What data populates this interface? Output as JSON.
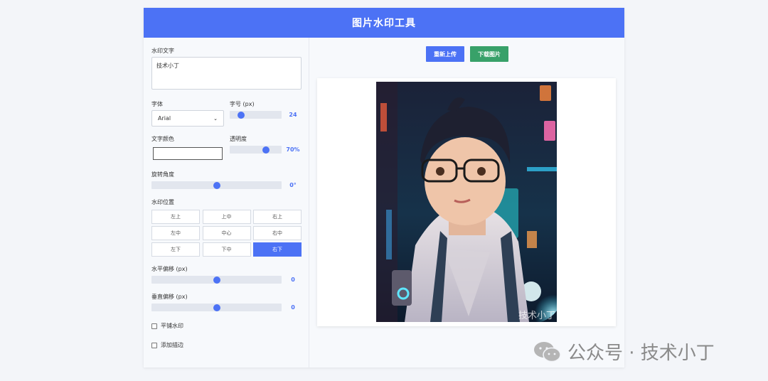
{
  "header": {
    "title": "图片水印工具"
  },
  "form": {
    "watermark_text_label": "水印文字",
    "watermark_text_value": "技术小丁",
    "font_label": "字体",
    "font_value": "Arial",
    "size_label": "字号 (px)",
    "size_value": "24",
    "size_level": 0.22,
    "color_label": "文字颜色",
    "color_value": "#ffffff",
    "opacity_label": "透明度",
    "opacity_value": "70%",
    "opacity_level": 0.7,
    "rotation_label": "旋转角度",
    "rotation_value": "0°",
    "rotation_level": 0.5,
    "position_label": "水印位置",
    "positions": [
      "左上",
      "上中",
      "右上",
      "左中",
      "中心",
      "右中",
      "左下",
      "下中",
      "右下"
    ],
    "active_position": "右下",
    "h_offset_label": "水平偏移 (px)",
    "h_offset_value": "0",
    "h_offset_level": 0.5,
    "v_offset_label": "垂直偏移 (px)",
    "v_offset_value": "0",
    "v_offset_level": 0.5,
    "tile_label": "平铺水印",
    "stroke_label": "添加描边"
  },
  "toolbar": {
    "reupload_label": "重新上传",
    "download_label": "下载图片"
  },
  "preview": {
    "watermark_overlay": "技术小丁"
  },
  "footer": {
    "account": "公众号 · 技术小丁"
  },
  "colors": {
    "accent": "#4c72f5",
    "download": "#38a169"
  }
}
